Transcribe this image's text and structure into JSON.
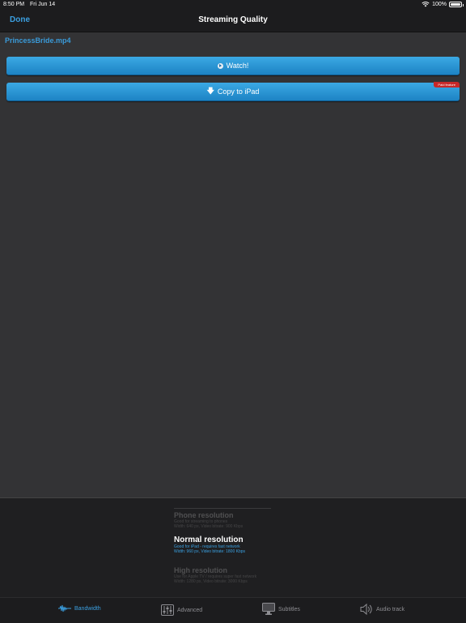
{
  "status": {
    "time": "8:50 PM",
    "date": "Fri Jun 14",
    "battery": "100%"
  },
  "nav": {
    "done_label": "Done",
    "title": "Streaming Quality"
  },
  "file": {
    "name": "PrincessBride.mp4"
  },
  "actions": {
    "watch_label": "Watch!",
    "copy_label": "Copy to iPad",
    "paid_badge": "Paid feature"
  },
  "picker": {
    "options": [
      {
        "title": "Phone resolution",
        "line1": "Good for streaming to phones",
        "line2": "Width: 640 px, Video bitrate: 900 Kbps"
      },
      {
        "title": "Normal resolution",
        "line1": "Good for iPad - requires fast network",
        "line2": "Width: 960 px, Video bitrate: 1800 Kbps"
      },
      {
        "title": "High resolution",
        "line1": "Use for Apple TV / requires super fast network",
        "line2": "Width: 1280 px, Video bitrate: 3000 Kbps"
      }
    ],
    "selected": "Normal resolution"
  },
  "tabs": [
    {
      "label": "Bandwidth",
      "icon": "waveform-icon",
      "active": true
    },
    {
      "label": "Advanced",
      "icon": "sliders-icon",
      "active": false
    },
    {
      "label": "Subtitles",
      "icon": "monitor-icon",
      "active": false
    },
    {
      "label": "Audio track",
      "icon": "speaker-icon",
      "active": false
    }
  ],
  "colors": {
    "accent": "#3b9fe0",
    "button": "#2595d4",
    "badge": "#c62828"
  }
}
